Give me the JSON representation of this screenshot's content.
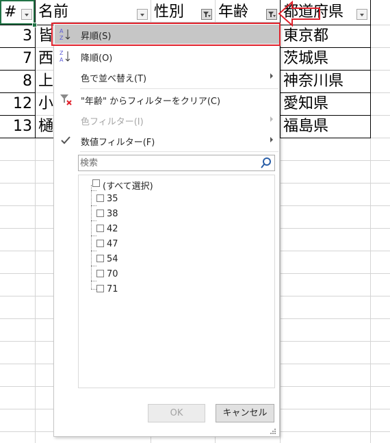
{
  "headers": [
    {
      "key": "num",
      "label": "#"
    },
    {
      "key": "name",
      "label": "名前"
    },
    {
      "key": "gender",
      "label": "性別"
    },
    {
      "key": "age",
      "label": "年齢"
    },
    {
      "key": "pref",
      "label": "都道府県"
    }
  ],
  "rows": [
    {
      "num": "3",
      "name": "皆",
      "pref": "東京都"
    },
    {
      "num": "7",
      "name": "西",
      "pref": "茨城県"
    },
    {
      "num": "8",
      "name": "上",
      "pref": "神奈川県"
    },
    {
      "num": "12",
      "name": "小",
      "pref": "愛知県"
    },
    {
      "num": "13",
      "name": "樋",
      "pref": "福島県"
    }
  ],
  "menu": {
    "sort_asc": "昇順(S)",
    "sort_desc": "降順(O)",
    "sort_color": "色で並べ替え(T)",
    "clear_filter": "\"年齢\" からフィルターをクリア(C)",
    "color_filter": "色フィルター(I)",
    "number_filter": "数値フィルター(F)",
    "search_placeholder": "検索",
    "select_all": "(すべて選択)",
    "values": [
      "35",
      "38",
      "42",
      "47",
      "54",
      "70",
      "71"
    ],
    "ok": "OK",
    "cancel": "キャンセル"
  },
  "colors": {
    "highlight_border": "#e0202a",
    "selected_cell": "#217346",
    "hover": "#c6c6c6"
  }
}
